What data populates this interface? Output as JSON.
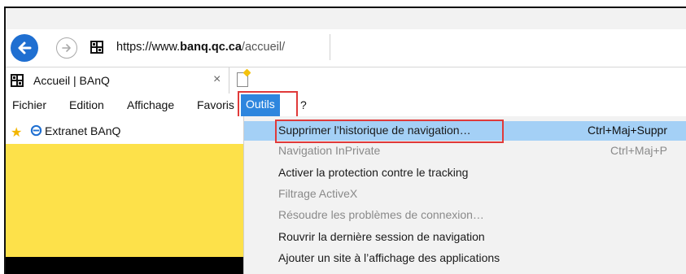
{
  "browser": {
    "url_prefix": "https://www.",
    "url_domain": "banq.qc.ca",
    "url_path": "/accueil/"
  },
  "tab": {
    "title": "Accueil | BAnQ",
    "close_glyph": "×"
  },
  "menu_bar": {
    "items": [
      {
        "label": "Fichier"
      },
      {
        "label": "Edition"
      },
      {
        "label": "Affichage"
      },
      {
        "label": "Favoris"
      },
      {
        "label": "Outils"
      },
      {
        "label": "?"
      }
    ]
  },
  "favorites": {
    "items": [
      {
        "label": "Extranet BAnQ"
      }
    ]
  },
  "tools_menu": {
    "items": [
      {
        "label": "Supprimer l’historique de navigation…",
        "shortcut": "Ctrl+Maj+Suppr",
        "state": "selected"
      },
      {
        "label": "Navigation InPrivate",
        "shortcut": "Ctrl+Maj+P",
        "state": "disabled"
      },
      {
        "label": "Activer la protection contre le tracking",
        "shortcut": "",
        "state": "enabled"
      },
      {
        "label": "Filtrage ActiveX",
        "shortcut": "",
        "state": "disabled"
      },
      {
        "label": "Résoudre les problèmes de connexion…",
        "shortcut": "",
        "state": "disabled"
      },
      {
        "label": "Rouvrir la dernière session de navigation",
        "shortcut": "",
        "state": "enabled"
      },
      {
        "label": "Ajouter un site à l’affichage des applications",
        "shortcut": "",
        "state": "enabled"
      }
    ]
  },
  "colors": {
    "accent_blue": "#2e86de",
    "highlight_red": "#e03a3a",
    "selection_blue": "#a4d0f6",
    "page_yellow": "#fde14a"
  },
  "icons": {
    "back": "arrow-left-icon",
    "forward": "arrow-right-icon",
    "site": "banq-favicon-icon",
    "favorites_star": "add-favorite-star-icon",
    "ie": "internet-explorer-icon",
    "new_tab": "new-tab-icon"
  }
}
